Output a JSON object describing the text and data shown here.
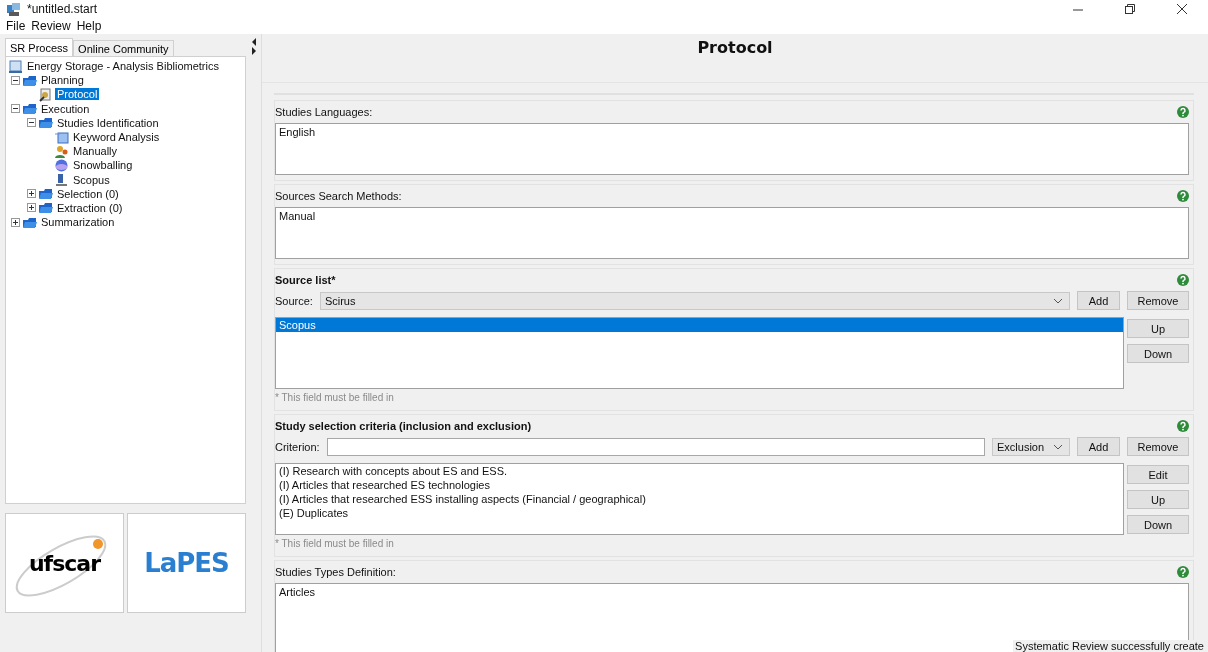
{
  "window": {
    "title": "*untitled.start"
  },
  "menu": [
    "File",
    "Review",
    "Help"
  ],
  "sidebar": {
    "tabs": [
      {
        "label": "SR Process",
        "selected": true
      },
      {
        "label": "Online Community",
        "selected": false
      }
    ],
    "tree": [
      {
        "label": "Energy Storage - Analysis Bibliometrics",
        "kind": "review",
        "selected": false,
        "children": [
          {
            "label": "Planning",
            "kind": "phase",
            "expanded": true,
            "selected": false,
            "children": [
              {
                "label": "Protocol",
                "kind": "protocol",
                "selected": true
              }
            ]
          },
          {
            "label": "Execution",
            "kind": "phase",
            "expanded": true,
            "selected": false,
            "children": [
              {
                "label": "Studies Identification",
                "kind": "phase",
                "expanded": true,
                "selected": false,
                "children": [
                  {
                    "label": "Keyword Analysis",
                    "kind": "keyword",
                    "selected": false
                  },
                  {
                    "label": "Manually",
                    "kind": "person",
                    "selected": false
                  },
                  {
                    "label": "Snowballing",
                    "kind": "sphere",
                    "selected": false
                  },
                  {
                    "label": "Scopus",
                    "kind": "search",
                    "selected": false
                  }
                ]
              },
              {
                "label": "Selection (0)",
                "kind": "phase",
                "expanded": false,
                "selected": false
              },
              {
                "label": "Extraction (0)",
                "kind": "phase",
                "expanded": false,
                "selected": false
              }
            ]
          },
          {
            "label": "Summarization",
            "kind": "phase",
            "expanded": false,
            "selected": false
          }
        ]
      }
    ],
    "logos": [
      {
        "text": "ufscar",
        "kind": "ufscar"
      },
      {
        "text": "LaPES",
        "kind": "lapes"
      }
    ]
  },
  "panel": {
    "title": "Protocol",
    "sections": [
      {
        "kind": "text_area",
        "label": "Studies Languages:",
        "value": "English"
      },
      {
        "kind": "text_area",
        "label": "Sources Search Methods:",
        "value": "Manual"
      },
      {
        "kind": "source_list",
        "label": "Source list*",
        "field_label": "Source:",
        "combo_value": "Scirus",
        "buttons": [
          "Add",
          "Remove"
        ],
        "items": [
          {
            "text": "Scopus",
            "selected": true
          }
        ],
        "side_buttons": [
          "Up",
          "Down"
        ],
        "hint": "* This field must be filled in"
      },
      {
        "kind": "criteria_list",
        "label": "Study selection criteria (inclusion and exclusion)",
        "field_label": "Criterion:",
        "type_value": "Exclusion",
        "buttons": [
          "Add",
          "Remove"
        ],
        "items": [
          {
            "text": "(I) Research with concepts about ES and ESS.",
            "selected": false
          },
          {
            "text": "(I) Articles that researched ES technologies",
            "selected": false
          },
          {
            "text": "(I) Articles that researched ESS installing aspects (Financial / geographical)",
            "selected": false
          },
          {
            "text": "(E) Duplicates",
            "selected": false
          }
        ],
        "side_buttons": [
          "Edit",
          "Up",
          "Down"
        ],
        "hint": "* This field must be filled in"
      },
      {
        "kind": "text_area",
        "label": "Studies Types Definition:",
        "value": "Articles"
      }
    ]
  },
  "status_bar": "Systematic Review successfully create"
}
